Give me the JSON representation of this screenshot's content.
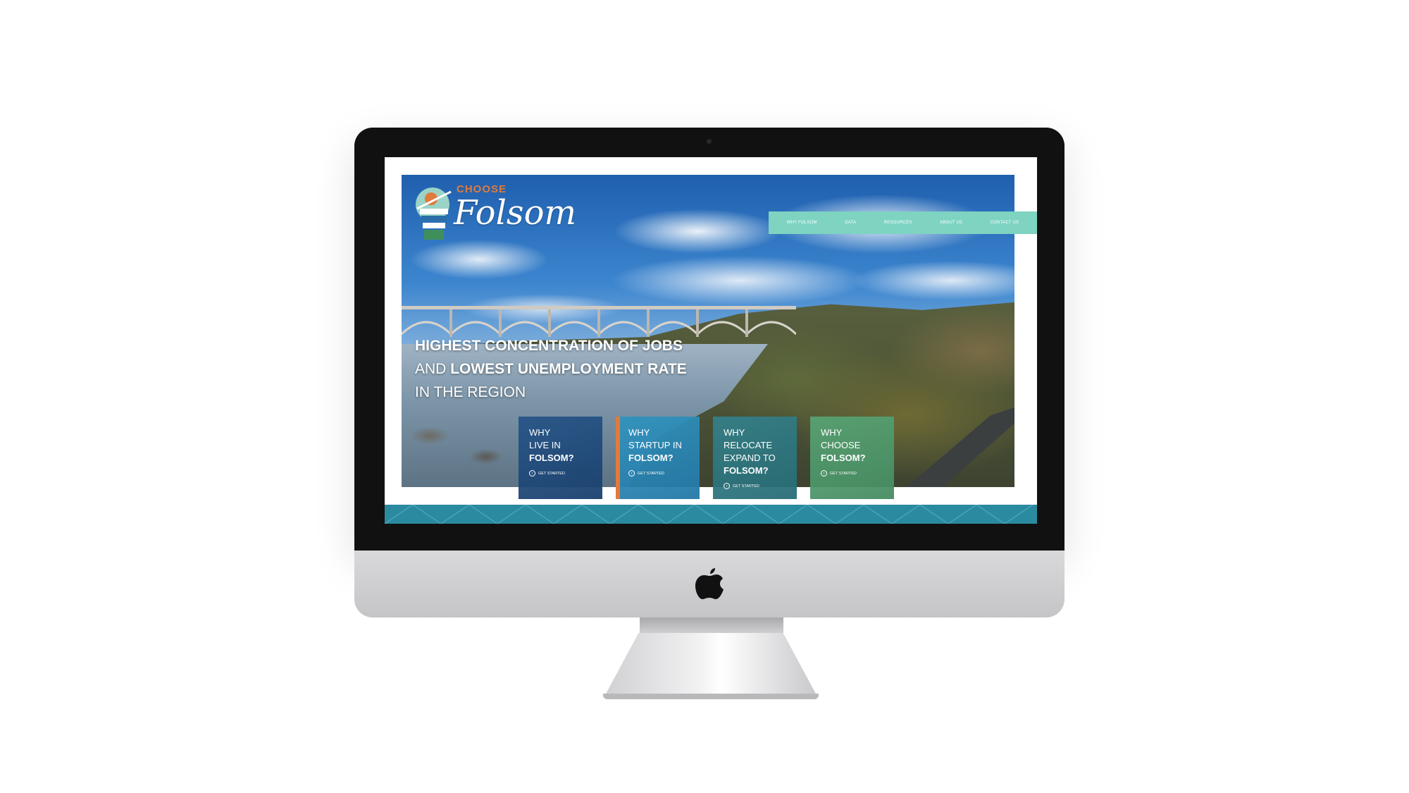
{
  "logo": {
    "top_word": "CHOOSE",
    "main_word": "Folsom"
  },
  "nav": {
    "items": [
      "WHY FOLSOM",
      "DATA",
      "RESOURCES",
      "ABOUT US",
      "CONTACT US"
    ]
  },
  "hero": {
    "line1_bold": "HIGHEST CONCENTRATION OF JOBS",
    "line2_light": "AND",
    "line2_bold": "LOWEST UNEMPLOYMENT RATE",
    "line3_light": "IN THE REGION"
  },
  "cards": [
    {
      "light": [
        "WHY",
        "LIVE IN"
      ],
      "bold": [
        "FOLSOM?"
      ],
      "cta": "GET STARTED"
    },
    {
      "light": [
        "WHY",
        "STARTUP IN"
      ],
      "bold": [
        "FOLSOM?"
      ],
      "cta": "GET STARTED"
    },
    {
      "light": [
        "WHY",
        "RELOCATE",
        "EXPAND TO"
      ],
      "bold": [
        "FOLSOM?"
      ],
      "cta": "GET STARTED"
    },
    {
      "light": [
        "WHY",
        "CHOOSE"
      ],
      "bold": [
        "FOLSOM?"
      ],
      "cta": "GET STARTED"
    }
  ],
  "colors": {
    "nav_bg": "#7ed3c1",
    "band": "#2a8aa0",
    "accent_orange": "#e07b3a"
  },
  "icons": {
    "device_logo": "apple-logo-icon",
    "cta": "arrow-circle-icon"
  }
}
